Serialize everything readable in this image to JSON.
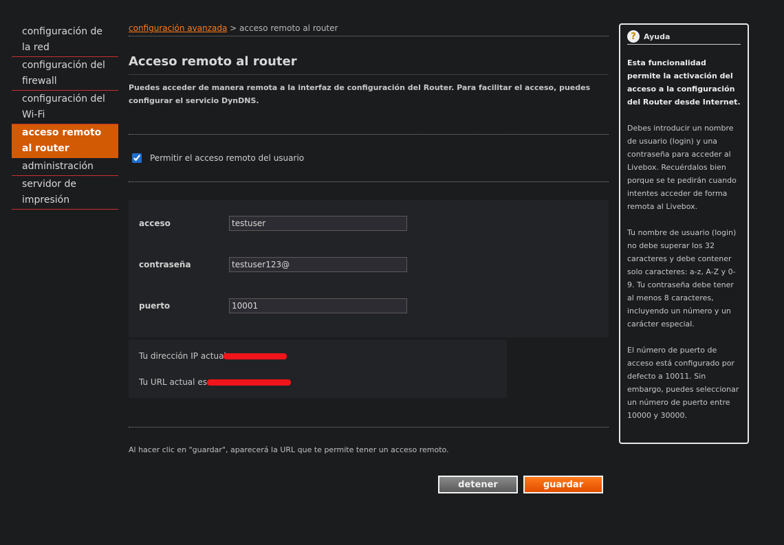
{
  "sidebar": {
    "items": [
      {
        "label": "configuración de la red"
      },
      {
        "label": "configuración del firewall"
      },
      {
        "label": "configuración del Wi-Fi"
      },
      {
        "label": "acceso remoto al router"
      },
      {
        "label": "administración"
      },
      {
        "label": "servidor de impresión"
      }
    ]
  },
  "breadcrumb": {
    "link": "configuración avanzada",
    "separator": " > ",
    "current": "acceso remoto al router"
  },
  "page": {
    "title": "Acceso remoto al router",
    "intro": "Puedes acceder de manera remota a la interfaz de configuración del Router. Para facilitar el acceso, puedes configurar el servicio DynDNS.",
    "checkbox_label": "Permitir el acceso remoto del usuario",
    "checkbox_checked": true
  },
  "form": {
    "acceso_label": "acceso",
    "acceso_value": "testuser",
    "password_label": "contraseña",
    "password_value": "testuser123@",
    "port_label": "puerto",
    "port_value": "10001"
  },
  "info": {
    "ip_text": "Tu dirección IP actual:",
    "url_text": "Tu URL actual es:"
  },
  "footnote": "Al hacer clic en \"guardar\", aparecerá la URL que te permite tener un acceso remoto.",
  "buttons": {
    "stop": "detener",
    "save": "guardar"
  },
  "help": {
    "title": "Ayuda",
    "lead": "Esta funcionalidad permite la activación del acceso a la configuración del Router desde Internet.",
    "p1": "Debes introducir un nombre de usuario (login) y una contraseña para acceder al Livebox. Recuérdalos bien porque se te pedirán cuando intentes acceder de forma remota al Livebox.",
    "p2": "Tu nombre de usuario (login) no debe superar los 32 caracteres y debe contener solo caracteres: a-z, A-Z y 0-9. Tu contraseña debe tener al menos 8 caracteres, incluyendo un número y un carácter especial.",
    "p3": "El número de puerto de acceso está configurado por defecto a 10011. Sin embargo, puedes seleccionar un número de puerto entre 10000 y 30000."
  },
  "colors": {
    "accent": "#d25a05",
    "sidebar_divider": "#c7312f",
    "redaction": "#f0141b"
  }
}
